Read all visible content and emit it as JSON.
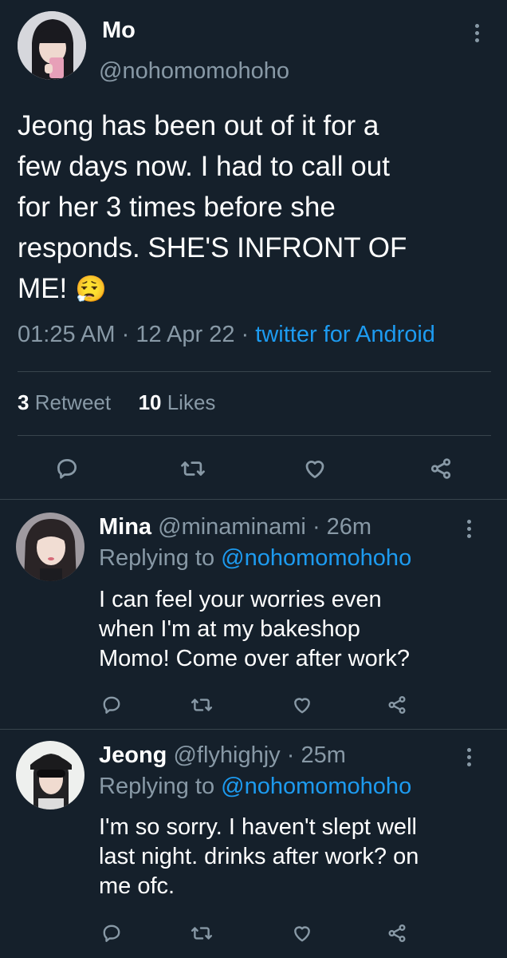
{
  "main_tweet": {
    "author_name": "Mo",
    "author_handle": "@nohomomohoho",
    "text_lines": [
      "Jeong has been out of it for a",
      "few days now. I had to call out",
      "for her 3 times before she",
      "responds. SHE'S INFRONT OF",
      "ME!"
    ],
    "emoji": "😮‍💨",
    "time": "01:25 AM",
    "date": "12 Apr 22",
    "separator": "·",
    "source": "twitter for Android",
    "retweet_count": "3",
    "retweet_label": "Retweet",
    "like_count": "10",
    "like_label": "Likes"
  },
  "replies": [
    {
      "name": "Mina",
      "handle": "@minaminami",
      "age": "· 26m",
      "replying_prefix": "Replying to",
      "replying_handle": "@nohomomohoho",
      "text_lines": [
        "I can feel your worries even",
        "when I'm at my bakeshop",
        "Momo! Come over after work?"
      ]
    },
    {
      "name": "Jeong",
      "handle": "@flyhighjy",
      "age": "· 25m",
      "replying_prefix": "Replying to",
      "replying_handle": "@nohomomohoho",
      "text_lines": [
        "I'm so sorry. I haven't slept well",
        "last night. drinks after work? on",
        "me ofc."
      ]
    }
  ],
  "colors": {
    "background": "#15202b",
    "muted": "#8899a6",
    "link": "#1d9bf0",
    "divider": "#38444d"
  },
  "icons": [
    "comment-icon",
    "retweet-icon",
    "like-icon",
    "share-icon",
    "more-icon"
  ]
}
